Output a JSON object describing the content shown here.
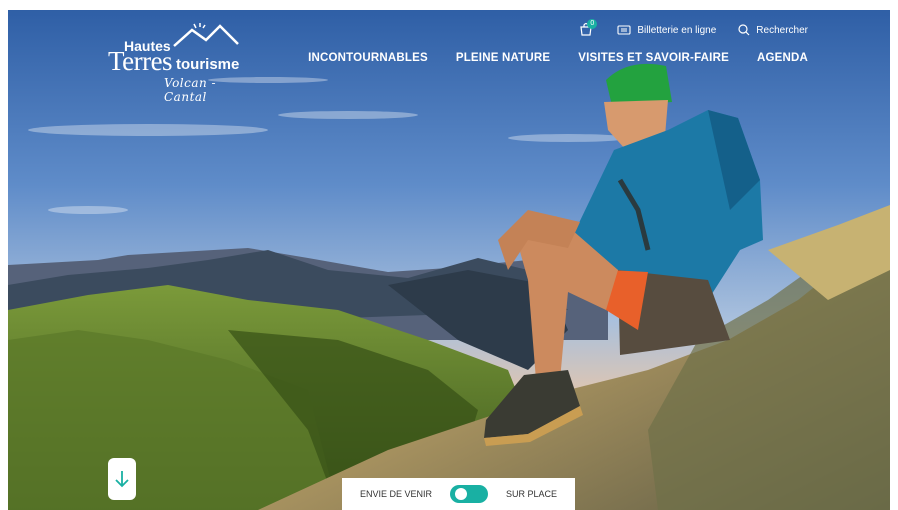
{
  "logo": {
    "line1": "Hautes",
    "line2": "Terres",
    "line3": "tourisme",
    "tagline": "Volcan - Cantal"
  },
  "topbar": {
    "cart_count": "0",
    "ticketing_label": "Billetterie en ligne",
    "search_label": "Rechercher"
  },
  "nav": {
    "items": [
      "INCONTOURNABLES",
      "PLEINE NATURE",
      "VISITES ET SAVOIR-FAIRE",
      "AGENDA"
    ]
  },
  "switch": {
    "left_label": "ENVIE DE VENIR",
    "right_label": "SUR PLACE"
  },
  "colors": {
    "accent": "#19b0a3"
  }
}
